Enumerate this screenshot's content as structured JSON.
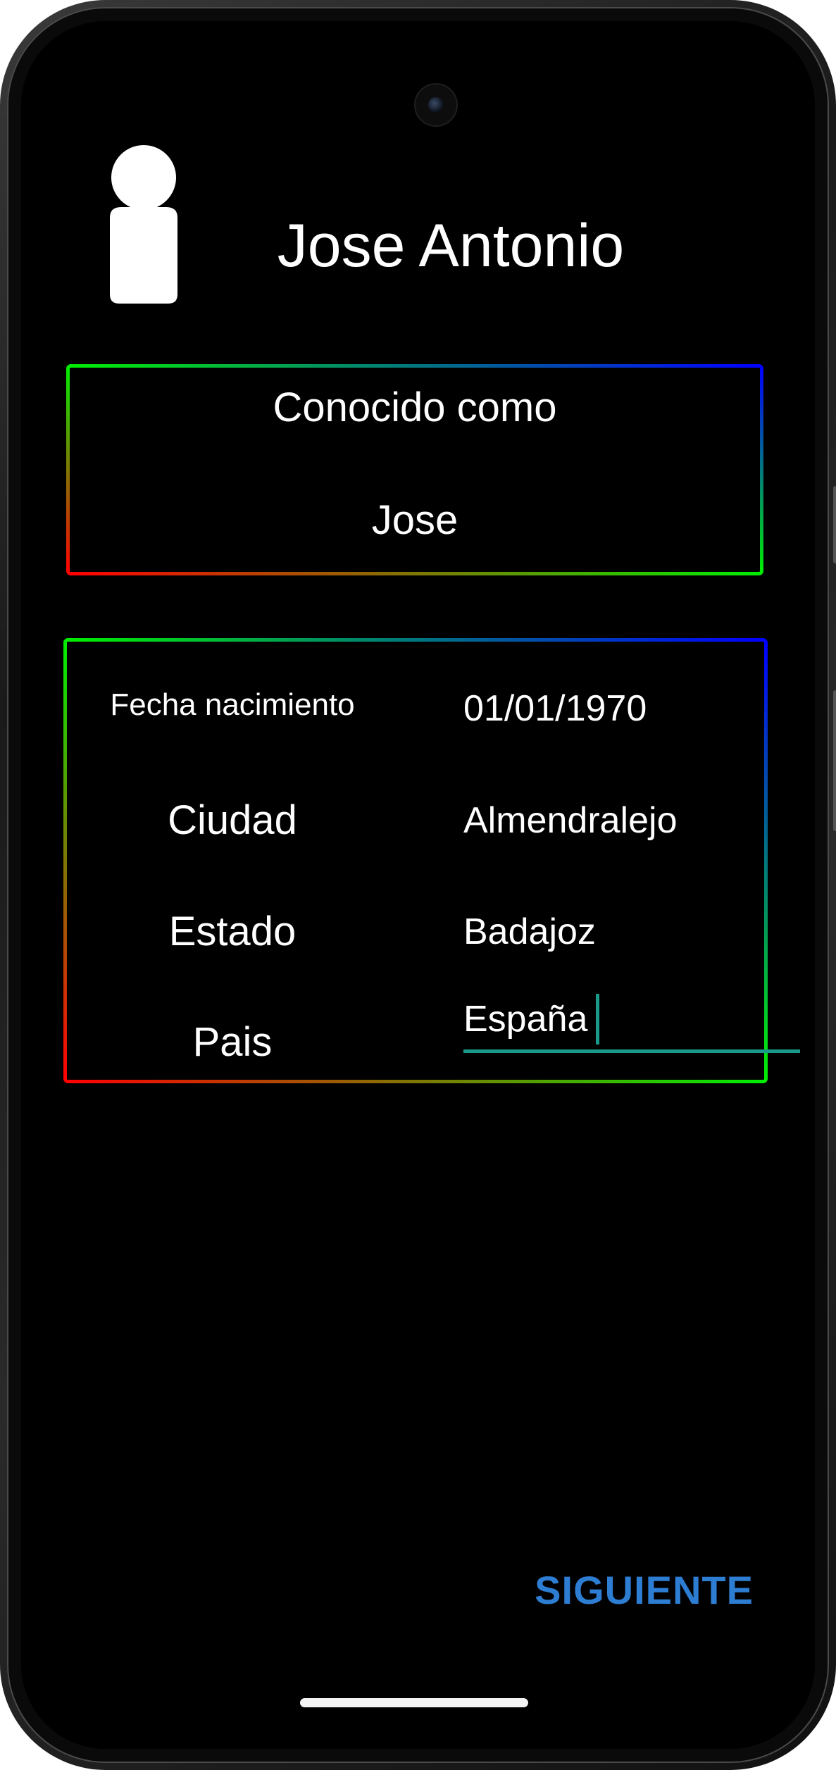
{
  "profile": {
    "name": "Jose Antonio"
  },
  "nickname": {
    "label": "Conocido como",
    "value": "Jose"
  },
  "details": {
    "birth_date_label": "Fecha nacimiento",
    "birth_date_value": "01/01/1970",
    "city_label": "Ciudad",
    "city_value": "Almendralejo",
    "state_label": "Estado",
    "state_value": "Badajoz",
    "country_label": "Pais",
    "country_value": "España"
  },
  "actions": {
    "next_label": "SIGUIENTE"
  },
  "colors": {
    "background": "#000000",
    "text": "#ffffff",
    "accent_button": "#2d7dd2",
    "input_underline": "#1a9a8a",
    "border_gradient": [
      "#ff0000",
      "#00ff00",
      "#0000ff"
    ]
  },
  "icons": {
    "avatar": "person-icon"
  }
}
